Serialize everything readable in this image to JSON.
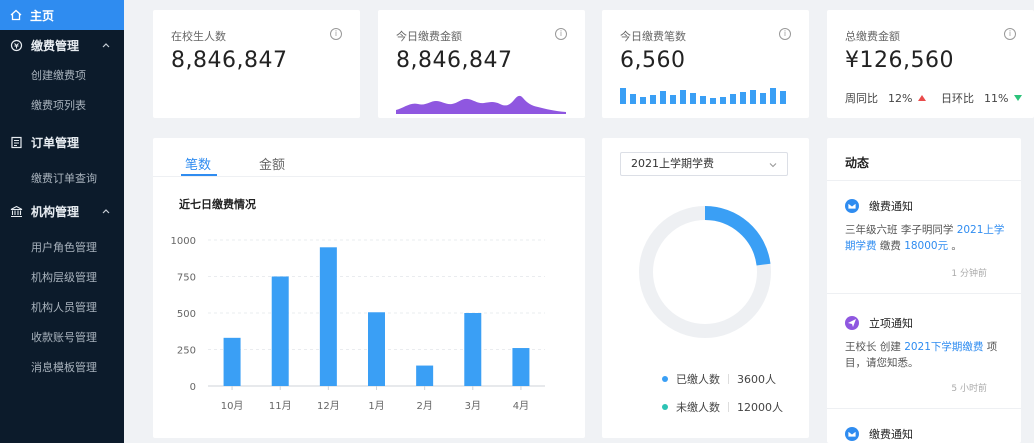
{
  "sidebar": {
    "home": "主页",
    "groups": [
      {
        "label": "缴费管理",
        "items": [
          "创建缴费项",
          "缴费项列表"
        ]
      },
      {
        "label": "订单管理",
        "items": [
          "缴费订单查询"
        ]
      },
      {
        "label": "机构管理",
        "items": [
          "用户角色管理",
          "机构层级管理",
          "机构人员管理",
          "收款账号管理",
          "消息模板管理"
        ]
      }
    ]
  },
  "kpis": [
    {
      "title": "在校生人数",
      "value": "8,846,847"
    },
    {
      "title": "今日缴费金额",
      "value": "8,846,847"
    },
    {
      "title": "今日缴费笔数",
      "value": "6,560"
    },
    {
      "title": "总缴费金额",
      "value": "¥126,560",
      "yoy_label": "周同比",
      "yoy_value": "12%",
      "mom_label": "日环比",
      "mom_value": "11%"
    }
  ],
  "tabs": {
    "count": "笔数",
    "amount": "金额"
  },
  "chart_title": "近七日缴费情况",
  "chart_data": {
    "type": "bar",
    "categories": [
      "10月",
      "11月",
      "12月",
      "1月",
      "2月",
      "3月",
      "4月"
    ],
    "values": [
      330,
      750,
      950,
      505,
      140,
      500,
      260
    ],
    "ylim": [
      0,
      1000
    ],
    "yticks": [
      "0",
      "250",
      "500",
      "750",
      "1000"
    ],
    "color": "#3a9ff5"
  },
  "donut": {
    "select_value": "2021上学期学费",
    "paid_fraction": 0.23,
    "paid_label": "已缴人数",
    "paid_value": "3600人",
    "unpaid_label": "未缴人数",
    "unpaid_value": "12000人",
    "paid_color": "#3a9ff5",
    "unpaid_color": "#2cc3b4"
  },
  "activity": {
    "title": "动态",
    "items": [
      {
        "title": "缴费通知",
        "text1": "三年级六班 李子明同学 ",
        "link1": "2021上学期学费",
        "text2": " 缴费 ",
        "link2": "18000元",
        "text3": " 。",
        "time": "1 分钟前"
      },
      {
        "title": "立项通知",
        "text1": "王校长 创建 ",
        "link1": "2021下学期缴费",
        "text2": " 项目，请您知悉。",
        "link2": "",
        "text3": "",
        "time": "5 小时前"
      },
      {
        "title": "缴费通知"
      }
    ]
  },
  "colors": {
    "accent": "#2f8cf0",
    "sidebar_bg": "#0c1b2b",
    "area_fill": "#8f57e0",
    "up": "#e94b4b",
    "down": "#2cc37a"
  }
}
